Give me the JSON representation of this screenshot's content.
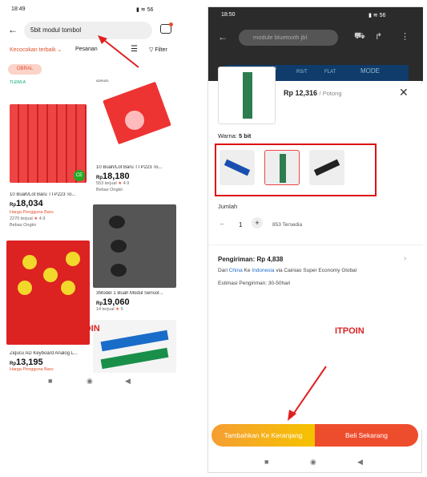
{
  "left": {
    "status_time": "18:49",
    "status_right": "56",
    "search_value": "5bit modul tombol",
    "tabs": [
      "Kecocokan terbaik",
      "Pesanan",
      "Filter"
    ],
    "obral_badge": "OBRAL",
    "brand_logo_text": "TLEWLA",
    "card2_brand": "ADRUEL",
    "products": [
      {
        "title": "10 Buah/Lot Baru TTP223 To...",
        "price_prefix": "Rp",
        "price": "18,180",
        "sold": "553 terjual",
        "rating": "4.9",
        "shipping": "Bebas Ongkir"
      },
      {
        "title": "10 Buah/Lot Baru TTP223 To...",
        "price_prefix": "Rp",
        "price": "18,034",
        "promo": "Harga Pengguna Baru",
        "sold": "2270 terjual",
        "rating": "4.9",
        "shipping": "Bebas Ongkir"
      },
      {
        "title": "3Model 1 Buah Modul Sensor...",
        "price_prefix": "Rp",
        "price": "19,060",
        "sold": "14 terjual",
        "rating": "5"
      },
      {
        "title": "Ziqucu AD Keyboard Analog L...",
        "price_prefix": "Rp",
        "price": "13,195",
        "promo": "Harga Pengguna Baru"
      }
    ],
    "watermark": "ITPOIN"
  },
  "right": {
    "status_time": "18:50",
    "status_right": "56",
    "search_placeholder": "module bluetooth jbl",
    "bg_text": [
      "Lt",
      "RS/T",
      "FLAT",
      "MODE"
    ],
    "price": "Rp 12,316",
    "unit": "/ Potong",
    "warna_label": "Warna:",
    "warna_value": "5 bit",
    "jumlah_label": "Jumlah",
    "qty": "1",
    "stock": "853 Tersedia",
    "ship_title": "Pengiriman: Rp 4,838",
    "ship_from_prefix": "Dari",
    "ship_from_a": "China",
    "ship_from_mid": "Ke",
    "ship_from_b": "Indonesia",
    "ship_from_suffix": "via Cainiao Super Economy Global",
    "ship_est": "Estimasi Pengiriman: 30-50hari",
    "watermark": "ITPOIN",
    "btn_cart": "Tambahkan Ke Keranjang",
    "btn_buy": "Beli Sekarang"
  }
}
